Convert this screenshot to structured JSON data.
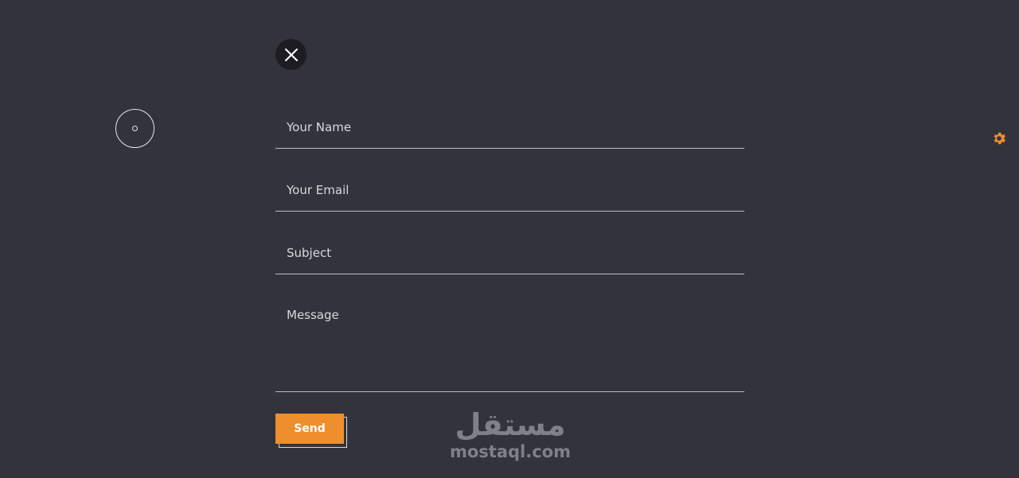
{
  "close_button": {
    "icon": "close-icon"
  },
  "settings": {
    "icon": "gear-icon",
    "color": "#ee8f2d"
  },
  "form": {
    "name_placeholder": "Your Name",
    "email_placeholder": "Your Email",
    "subject_placeholder": "Subject",
    "message_placeholder": "Message",
    "send_label": "Send"
  },
  "watermark": {
    "arabic": "مستقل",
    "latin": "mostaql.com"
  },
  "colors": {
    "background": "#33333c",
    "accent": "#ee8f2d"
  }
}
